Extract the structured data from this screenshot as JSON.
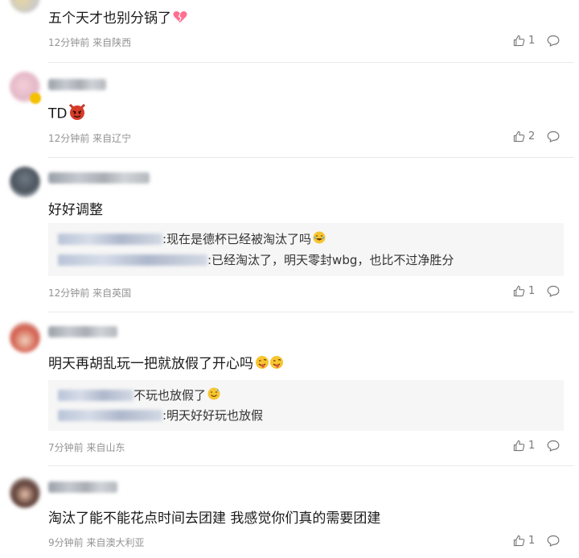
{
  "comments": [
    {
      "text": "五个天才也别分锅了",
      "emoji": "broken-heart-emoji",
      "time": "12分钟前",
      "location": "来自陕西",
      "likes": "1"
    },
    {
      "text": "TD",
      "emoji": "angry-devil-emoji",
      "time": "12分钟前",
      "location": "来自辽宁",
      "likes": "2"
    },
    {
      "text": "好好调整",
      "time": "12分钟前",
      "location": "来自英国",
      "likes": "1",
      "replies": [
        {
          "text": ":现在是德杯已经被淘汰了吗",
          "emoji": "laughing-emoji"
        },
        {
          "text": ":已经淘汰了，明天零封wbg，也比不过净胜分"
        }
      ]
    },
    {
      "text": "明天再胡乱玩一把就放假了开心吗",
      "emoji": "tongue-wink-emoji",
      "time": "7分钟前",
      "location": "来自山东",
      "likes": "1",
      "replies": [
        {
          "text": "不玩也放假了",
          "emoji": "sweat-smile-emoji"
        },
        {
          "text": ":明天好好玩也放假"
        }
      ]
    },
    {
      "text": "淘汰了能不能花点时间去团建 我感觉你们真的需要团建",
      "time": "9分钟前",
      "location": "来自澳大利亚",
      "likes": "1"
    }
  ],
  "icons": {
    "like": "thumbs-up-icon",
    "reply": "comment-bubble-icon"
  },
  "colors": {
    "meta": "#939393",
    "reply_bg": "#f6f6f6",
    "divider": "#e9e9e9"
  }
}
